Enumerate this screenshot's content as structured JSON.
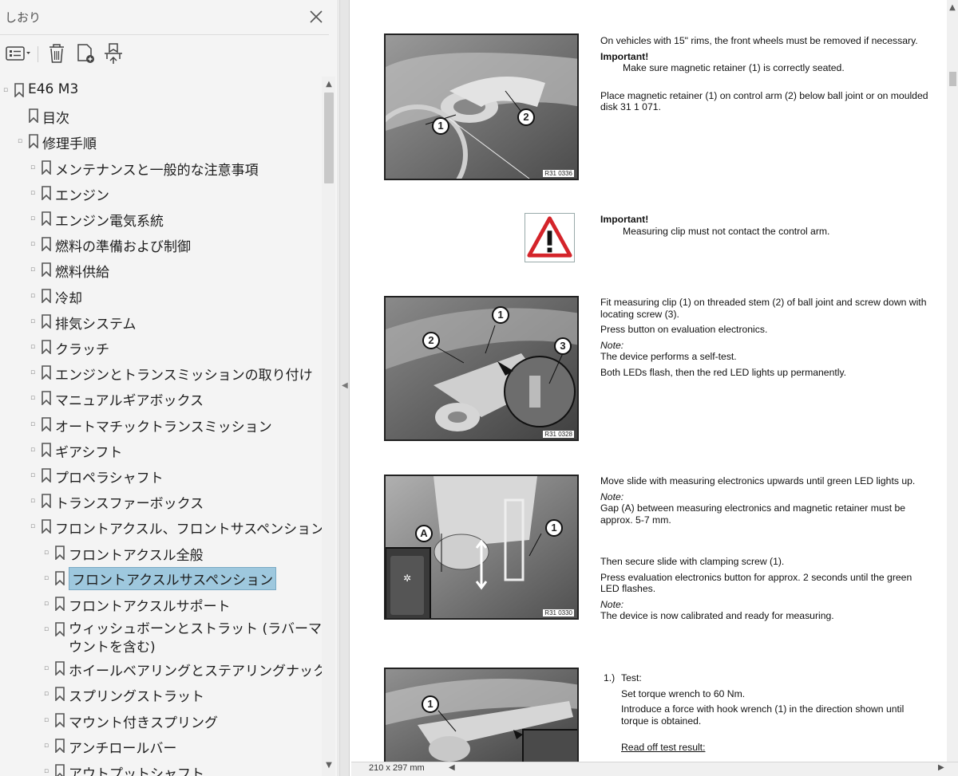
{
  "sidebar": {
    "title": "しおり",
    "tree": [
      {
        "label": "E46 M3",
        "level": 0,
        "expander": "collapse"
      },
      {
        "label": "目次",
        "level": 1,
        "expander": "none"
      },
      {
        "label": "修理手順",
        "level": 1,
        "expander": "collapse"
      },
      {
        "label": "メンテナンスと一般的な注意事項",
        "level": 2,
        "expander": "expand"
      },
      {
        "label": "エンジン",
        "level": 2,
        "expander": "expand"
      },
      {
        "label": "エンジン電気系統",
        "level": 2,
        "expander": "expand"
      },
      {
        "label": "燃料の準備および制御",
        "level": 2,
        "expander": "expand"
      },
      {
        "label": "燃料供給",
        "level": 2,
        "expander": "expand"
      },
      {
        "label": "冷却",
        "level": 2,
        "expander": "expand"
      },
      {
        "label": "排気システム",
        "level": 2,
        "expander": "expand"
      },
      {
        "label": "クラッチ",
        "level": 2,
        "expander": "expand"
      },
      {
        "label": "エンジンとトランスミッションの取り付け",
        "level": 2,
        "expander": "expand"
      },
      {
        "label": "マニュアルギアボックス",
        "level": 2,
        "expander": "expand"
      },
      {
        "label": "オートマチックトランスミッション",
        "level": 2,
        "expander": "expand"
      },
      {
        "label": "ギアシフト",
        "level": 2,
        "expander": "expand"
      },
      {
        "label": "プロペラシャフト",
        "level": 2,
        "expander": "expand"
      },
      {
        "label": "トランスファーボックス",
        "level": 2,
        "expander": "expand"
      },
      {
        "label": "フロントアクスル、フロントサスペンション",
        "level": 2,
        "expander": "collapse"
      },
      {
        "label": "フロントアクスル全般",
        "level": 3,
        "expander": "expand"
      },
      {
        "label": "フロントアクスルサスペンション",
        "level": 3,
        "expander": "expand",
        "selected": true
      },
      {
        "label": "フロントアクスルサポート",
        "level": 3,
        "expander": "expand"
      },
      {
        "label": "ウィッシュボーンとストラット (ラバーマウントを含む)",
        "level": 3,
        "expander": "expand",
        "wrap": true
      },
      {
        "label": "ホイールベアリングとステアリングナックル",
        "level": 3,
        "expander": "expand"
      },
      {
        "label": "スプリングストラット",
        "level": 3,
        "expander": "expand"
      },
      {
        "label": "マウント付きスプリング",
        "level": 3,
        "expander": "expand"
      },
      {
        "label": "アンチロールバー",
        "level": 3,
        "expander": "expand"
      },
      {
        "label": "アウトプットシャフト",
        "level": 3,
        "expander": "expand"
      }
    ]
  },
  "document": {
    "figures": [
      {
        "code": "R31 0336",
        "callouts": [
          "1",
          "2"
        ]
      },
      {
        "code": "R31 0328",
        "callouts": [
          "1",
          "2",
          "3"
        ]
      },
      {
        "code": "R31 0330",
        "callouts": [
          "A",
          "1"
        ]
      },
      {
        "code": "",
        "callouts": [
          "1"
        ]
      }
    ],
    "block1": {
      "p1": "On vehicles with 15\" rims, the front wheels must be removed if necessary.",
      "important": "Important!",
      "p2": "Make sure magnetic retainer (1) is correctly seated.",
      "p3": "Place magnetic retainer (1) on control arm (2) below ball joint or on moulded disk 31 1 071."
    },
    "block2": {
      "important": "Important!",
      "p1": "Measuring clip must not contact the control arm."
    },
    "block3": {
      "p1": "Fit measuring clip (1) on threaded stem (2) of ball joint and screw down with locating screw (3).",
      "p2": "Press button on evaluation electronics.",
      "note": "Note:",
      "p3": "The device performs a self-test.",
      "p4": "Both LEDs flash, then the red LED lights up permanently."
    },
    "block4": {
      "p1": "Move slide with measuring electronics upwards until green LED lights up.",
      "note1": "Note:",
      "p2": "Gap (A) between measuring electronics and magnetic retainer must be approx. 5-7 mm.",
      "p3": "Then secure slide with clamping screw (1).",
      "p4": "Press evaluation electronics button for approx. 2 seconds until the green LED flashes.",
      "note2": "Note:",
      "p5": "The device is now calibrated and ready for measuring."
    },
    "block5": {
      "num": "1.)",
      "p1": "Test:",
      "p2": "Set torque wrench to 60 Nm.",
      "p3": "Introduce a force with hook wrench (1) in the direction shown until torque is obtained.",
      "p4": "Read off test result:"
    }
  },
  "status": {
    "page_size": "210 x 297 mm"
  },
  "icons": {
    "close": "close-icon",
    "options": "options-menu-icon",
    "delete": "trash-icon",
    "new_bookmark": "new-bookmark-icon",
    "find_bookmark": "find-current-bookmark-icon",
    "bookmark": "bookmark-icon",
    "warning": "warning-triangle-icon"
  }
}
